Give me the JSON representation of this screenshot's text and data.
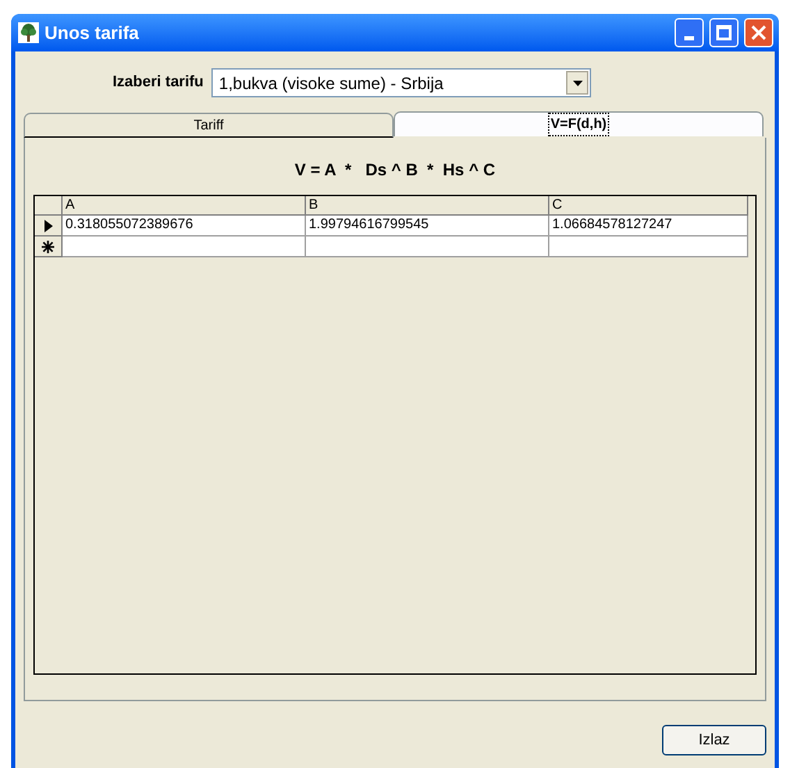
{
  "window": {
    "title": "Unos tarifa"
  },
  "tariff_select": {
    "label": "Izaberi tarifu",
    "value": "1,bukva (visoke sume) - Srbija"
  },
  "tabs": [
    {
      "label": "Tariff",
      "selected": false
    },
    {
      "label": "V=F(d,h)",
      "selected": true
    }
  ],
  "formula": "V = A  *   Ds ^ B  *  Hs ^ C",
  "table": {
    "columns": [
      "A",
      "B",
      "C"
    ],
    "rows": [
      {
        "cells": [
          "0.318055072389676",
          "1.99794616799545",
          "1.06684578127247"
        ],
        "kind": "current"
      },
      {
        "cells": [
          "",
          "",
          ""
        ],
        "kind": "new"
      }
    ]
  },
  "buttons": [
    "Izlaz"
  ]
}
